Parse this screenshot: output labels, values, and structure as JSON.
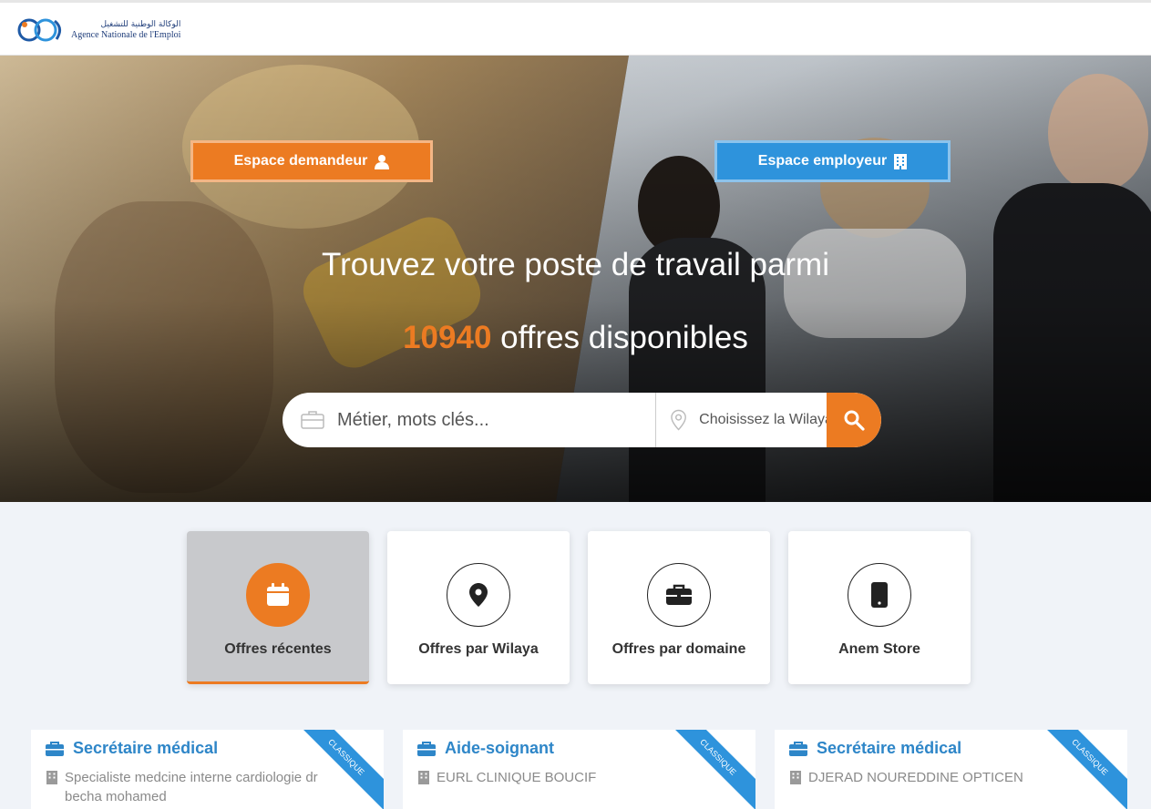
{
  "header": {
    "logo_ar": "الوكالة الوطنية للتشغيل",
    "logo_fr": "Agence Nationale de l'Emploi"
  },
  "hero": {
    "btn_demandeur": "Espace demandeur",
    "btn_employeur": "Espace employeur",
    "title": "Trouvez votre poste de travail parmi",
    "count": "10940",
    "count_suffix": "offres disponibles"
  },
  "search": {
    "keywords_placeholder": "Métier, mots clés...",
    "wilaya_placeholder": "Choisissez la Wilaya"
  },
  "categories": [
    {
      "label": "Offres récentes",
      "icon": "calendar-icon"
    },
    {
      "label": "Offres par Wilaya",
      "icon": "map-pin-icon"
    },
    {
      "label": "Offres par domaine",
      "icon": "briefcase-icon"
    },
    {
      "label": "Anem Store",
      "icon": "mobile-phone-icon"
    }
  ],
  "offers": [
    {
      "title": "Secrétaire médical",
      "company": "Specialiste medcine interne cardiologie dr becha mohamed",
      "badge": "CLASSIQUE"
    },
    {
      "title": "Aide-soignant",
      "company": "EURL CLINIQUE BOUCIF",
      "badge": "CLASSIQUE"
    },
    {
      "title": "Secrétaire médical",
      "company": "DJERAD NOUREDDINE OPTICEN",
      "badge": "CLASSIQUE"
    }
  ],
  "colors": {
    "orange": "#ec7b22",
    "blue": "#2e93dc",
    "title_blue": "#2e86c8"
  }
}
